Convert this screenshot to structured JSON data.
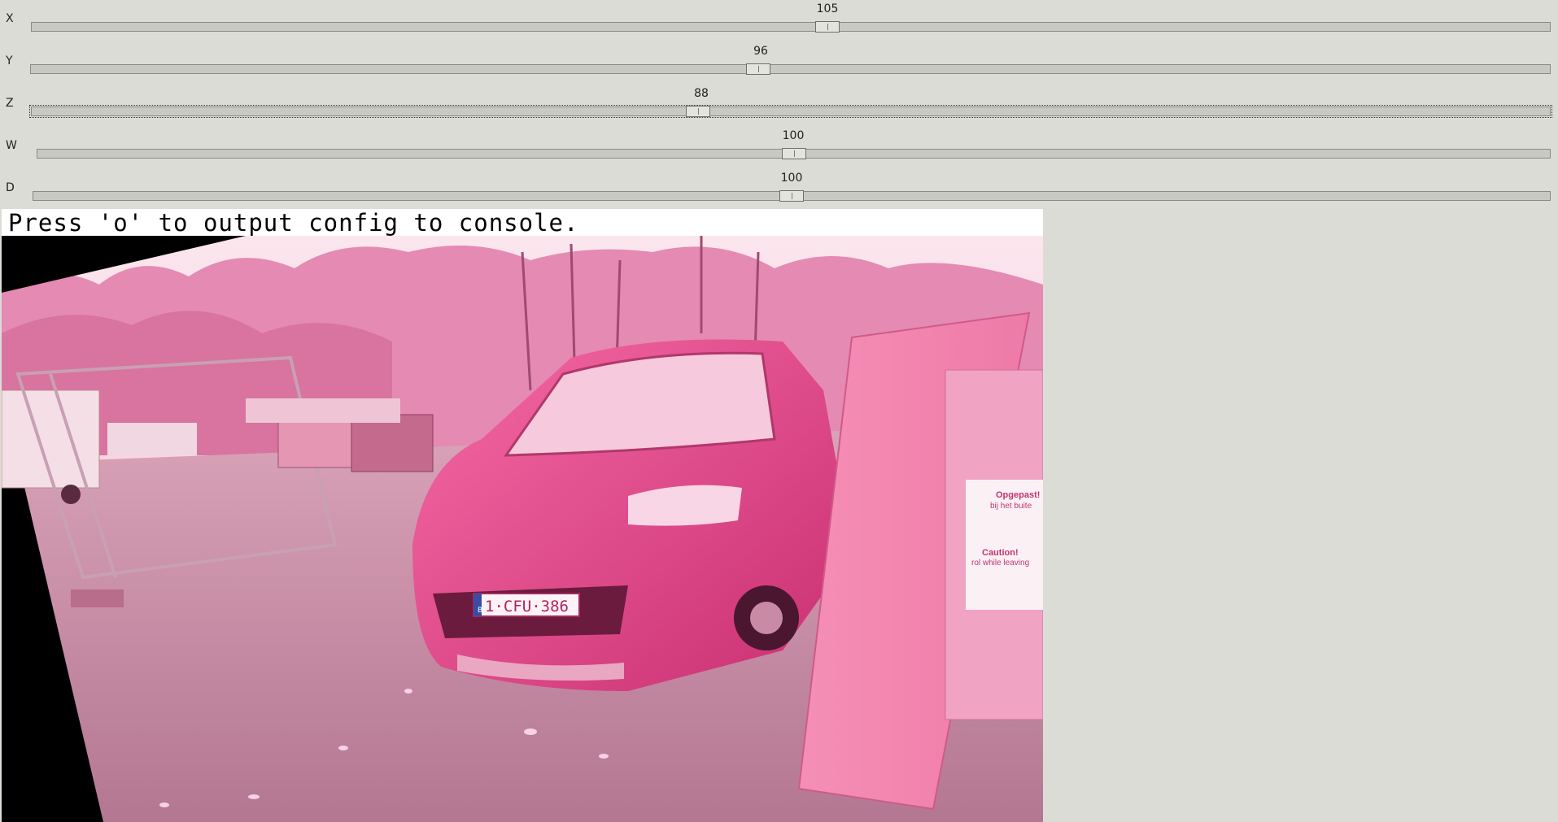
{
  "sliders": [
    {
      "label": "X",
      "value": "105",
      "fraction": 0.524
    },
    {
      "label": "Y",
      "value": "96",
      "fraction": 0.479
    },
    {
      "label": "Z",
      "value": "88",
      "fraction": 0.439
    },
    {
      "label": "W",
      "value": "100",
      "fraction": 0.5
    },
    {
      "label": "D",
      "value": "100",
      "fraction": 0.5
    }
  ],
  "caption": "Press 'o' to output config to console.",
  "photo": {
    "plate": "1·CFU·386",
    "plate_prefix": "B",
    "sign_title_nl": "Opgepast!",
    "sign_sub_nl": "bij het buite",
    "sign_title_en": "Caution!",
    "sign_sub_en": "rol while leaving"
  }
}
